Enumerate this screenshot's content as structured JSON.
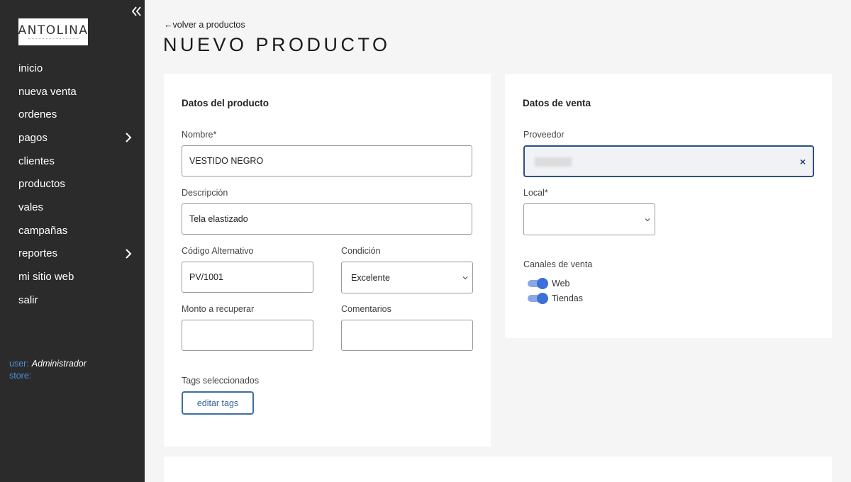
{
  "sidebar": {
    "logo_text": "ANTOLINA",
    "nav": [
      {
        "label": "inicio",
        "has_submenu": false
      },
      {
        "label": "nueva venta",
        "has_submenu": false
      },
      {
        "label": "ordenes",
        "has_submenu": false
      },
      {
        "label": "pagos",
        "has_submenu": true
      },
      {
        "label": "clientes",
        "has_submenu": false
      },
      {
        "label": "productos",
        "has_submenu": false
      },
      {
        "label": "vales",
        "has_submenu": false
      },
      {
        "label": "campañas",
        "has_submenu": false
      },
      {
        "label": "reportes",
        "has_submenu": true
      },
      {
        "label": "mi sitio web",
        "has_submenu": false
      },
      {
        "label": "salir",
        "has_submenu": false
      }
    ],
    "user_label": "user:",
    "user_value": "Administrador",
    "store_label": "store:",
    "store_value": ""
  },
  "header": {
    "back_link": "←volver a productos",
    "title": "NUEVO PRODUCTO"
  },
  "producto": {
    "title": "Datos del producto",
    "nombre_label": "Nombre*",
    "nombre_value": "VESTIDO NEGRO",
    "descripcion_label": "Descripción",
    "descripcion_value": "Tela elastizado",
    "codigo_label": "Código Alternativo",
    "codigo_value": "PV/1001",
    "condicion_label": "Condición",
    "condicion_value": "Excelente",
    "monto_label": "Monto a recuperar",
    "monto_value": "",
    "comentarios_label": "Comentarios",
    "comentarios_value": "",
    "tags_label": "Tags seleccionados",
    "tags_button": "editar tags"
  },
  "venta": {
    "title": "Datos de venta",
    "proveedor_label": "Proveedor",
    "proveedor_clear": "×",
    "local_label": "Local*",
    "local_value": "",
    "canales_label": "Canales de venta",
    "canales": [
      {
        "label": "Web",
        "enabled": true
      },
      {
        "label": "Tiendas",
        "enabled": true
      }
    ]
  },
  "colors": {
    "sidebar_bg": "#2b2b2b",
    "accent": "#3d6fd8",
    "button_border": "#3e6ea4",
    "user_label": "#4a90d9"
  }
}
